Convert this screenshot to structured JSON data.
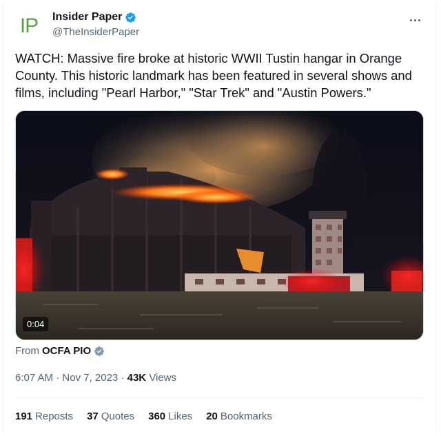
{
  "author": {
    "avatar_text": "IP",
    "display_name": "Insider Paper",
    "handle": "@TheInsiderPaper",
    "verified": true
  },
  "tweet": {
    "text": "WATCH: Massive fire broke at historic WWII Tustin hangar in Orange County. This historic landmark has been featured in several shows and films, including \"Pearl Harbor,\" \"Star Trek\" and \"Austin Powers.\""
  },
  "media": {
    "type": "video",
    "duration": "0:04"
  },
  "source": {
    "prefix": "From",
    "name": "OCFA PIO"
  },
  "meta": {
    "time": "6:07 AM",
    "separator": "·",
    "date": "Nov 7, 2023",
    "views_count": "43K",
    "views_label": "Views"
  },
  "stats": [
    {
      "count": "191",
      "label": "Reposts"
    },
    {
      "count": "37",
      "label": "Quotes"
    },
    {
      "count": "360",
      "label": "Likes"
    },
    {
      "count": "20",
      "label": "Bookmarks"
    }
  ],
  "colors": {
    "verified_blue": "#1d9bf0",
    "text_primary": "#0f1419",
    "text_secondary": "#536471",
    "avatar_green": "#5aa33f",
    "fire_orange": "#ff8a1e"
  },
  "icons": {
    "verified": "verified-badge-icon",
    "more": "more-dots-icon",
    "source_badge": "gray-verified-badge-icon"
  }
}
